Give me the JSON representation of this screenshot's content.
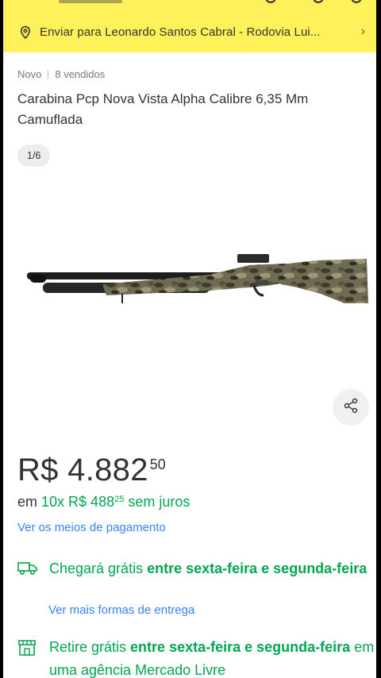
{
  "header": {
    "shipping_text": "Enviar para Leonardo Santos Cabral - Rodovia Lui...",
    "shipping_chevron": "›"
  },
  "product": {
    "condition": "Novo",
    "sold": "8 vendidos",
    "title": "Carabina Pcp Nova Vista Alpha Calibre 6,35 Mm Camuflada",
    "image_counter": "1/6"
  },
  "price": {
    "main": "R$ 4.882",
    "cents": "50"
  },
  "installments": {
    "prefix": "em",
    "count": "10x",
    "amount": "R$ 488",
    "cents": "25",
    "suffix": "sem juros"
  },
  "payment_link": "Ver os meios de pagamento",
  "delivery": {
    "regular": "Chegará grátis",
    "bold": "entre sexta-feira e segunda-feira",
    "link": "Ver mais formas de entrega"
  },
  "pickup": {
    "regular_a": "Retire grátis",
    "bold": "entre sexta-feira e segunda-feira",
    "regular_b": "em uma agência Mercado Livre"
  },
  "colors": {
    "header_yellow": "#fff159",
    "green": "#00a650",
    "link_blue": "#3483fa"
  },
  "icons": {
    "location": "map-pin-icon",
    "share": "share-icon",
    "delivery": "truck-icon",
    "pickup": "store-icon"
  }
}
